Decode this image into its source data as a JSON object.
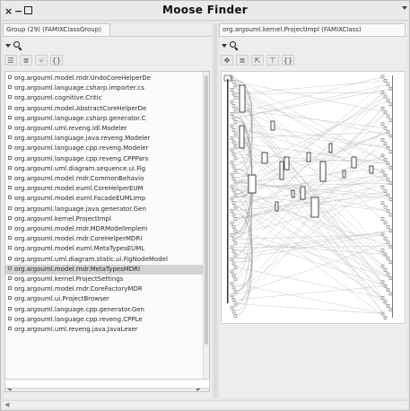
{
  "window": {
    "title": "Moose Finder"
  },
  "left": {
    "tab_label": "Group (29) (FAMIXClassGroup)",
    "search_placeholder": "",
    "selected_index": 19,
    "items": [
      "org.argouml.model.mdr.UndoCoreHelperDe",
      "org.argouml.language.csharp.importer.cs",
      "org.argouml.cognitive.Critic",
      "org.argouml.model.AbstractCoreHelperDe",
      "org.argouml.language.csharp.generator.C",
      "org.argouml.uml.reveng.idl.Modeler",
      "org.argouml.language.java.reveng.Modeler",
      "org.argouml.language.cpp.reveng.Modeler",
      "org.argouml.language.cpp.reveng.CPPPars",
      "org.argouml.uml.diagram.sequence.ui.Fig",
      "org.argouml.model.mdr.CommonBehavio",
      "org.argouml.model.euml.CoreHelperEUM",
      "org.argouml.model.euml.FacadeEUMLImp",
      "org.argouml.language.java.generator.Gen",
      "org.argouml.kernel.ProjectImpl",
      "org.argouml.model.mdr.MDRModelImplem",
      "org.argouml.model.mdr.CoreHelperMDRI",
      "org.argouml.model.euml.MetaTypesEUML",
      "org.argouml.uml.diagram.static.ui.FigNodeModel",
      "org.argouml.model.mdr.MetaTypesMDRI",
      "org.argouml.kernel.ProjectSettings",
      "org.argouml.model.mdr.CoreFactoryMDR",
      "org.argouml.ui.ProjectBrowser",
      "org.argouml.language.cpp.generator.Gen",
      "org.argouml.language.cpp.reveng.CPPLe",
      "org.argouml.uml.reveng.java.JavaLexer"
    ]
  },
  "right": {
    "tab_label": "org.argouml.kernel.ProjectImpl (FAMIXClass)",
    "search_placeholder": ""
  },
  "icons": {
    "close": "close-icon",
    "minimize": "minimize-icon",
    "maximize": "maximize-icon",
    "search": "search-icon"
  },
  "colors": {
    "selection": "#d3d3d3",
    "pane_bg": "#ededed"
  }
}
